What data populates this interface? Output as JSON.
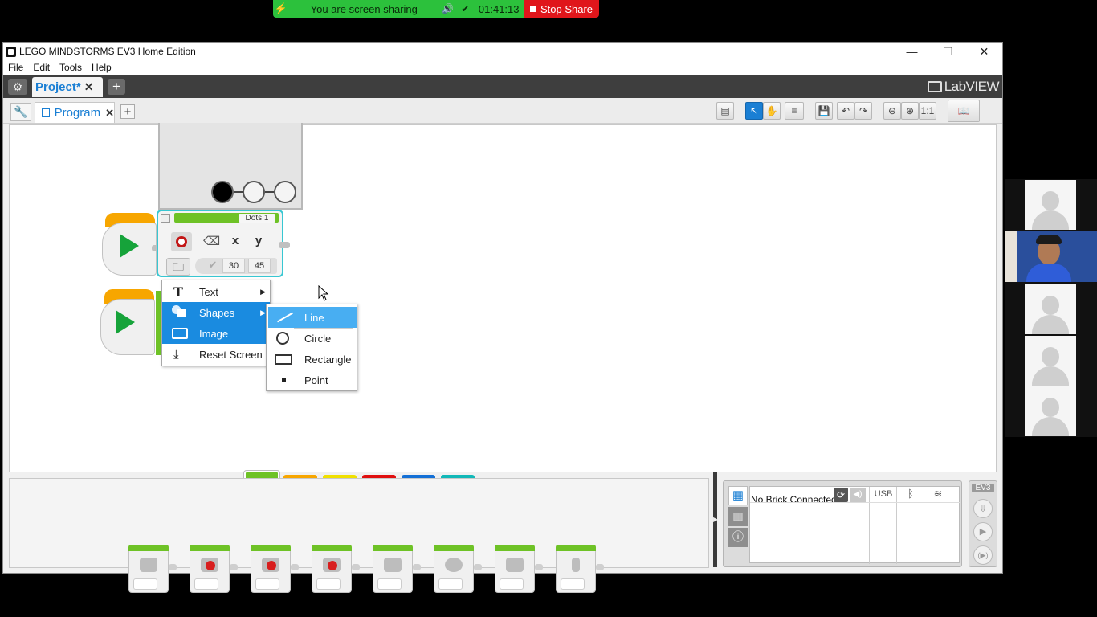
{
  "share_bar": {
    "message": "You are screen sharing",
    "timer": "01:41:13",
    "stop_label": "Stop Share"
  },
  "window": {
    "title": "LEGO MINDSTORMS EV3 Home Edition",
    "controls": {
      "minimize": "—",
      "restore": "❐",
      "close": "✕"
    }
  },
  "menu": [
    "File",
    "Edit",
    "Tools",
    "Help"
  ],
  "project_tab": {
    "label": "Project*",
    "close": "✕",
    "add": "+"
  },
  "brand": "LabVIEW",
  "program_tab": {
    "label": "Program",
    "close": "✕",
    "add": "+"
  },
  "display_block": {
    "header_label": "Dots 1",
    "param_x": "x",
    "param_y": "y",
    "value_x": "30",
    "value_y": "45"
  },
  "context_menu": {
    "items": [
      {
        "label": "Text",
        "icon": "text-T-icon",
        "has_submenu": true
      },
      {
        "label": "Shapes",
        "icon": "shapes-icon",
        "has_submenu": true,
        "selected": true
      },
      {
        "label": "Image",
        "icon": "folder-icon",
        "has_submenu": false,
        "selected": true
      },
      {
        "label": "Reset Screen",
        "icon": "download-icon",
        "has_submenu": false
      }
    ]
  },
  "shapes_submenu": {
    "items": [
      {
        "label": "Line",
        "icon": "line-icon",
        "selected": true
      },
      {
        "label": "Circle",
        "icon": "circle-icon"
      },
      {
        "label": "Rectangle",
        "icon": "rectangle-icon"
      },
      {
        "label": "Point",
        "icon": "point-icon"
      }
    ]
  },
  "palette_tabs": [
    "#6ec226",
    "#f7a600",
    "#f0e000",
    "#e01010",
    "#1470d6",
    "#12b8b8"
  ],
  "hardware": {
    "status": "No Brick Connected",
    "usb_label": "USB",
    "ev3_label": "EV3"
  },
  "colors": {
    "accent_blue": "#1a8be0",
    "share_green": "#2cc13c",
    "stop_red": "#e0161b"
  }
}
